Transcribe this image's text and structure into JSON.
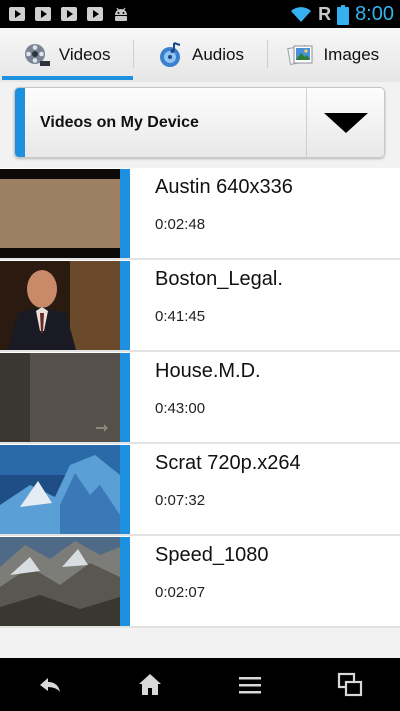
{
  "status_bar": {
    "notification_icons": [
      "youtube-icon",
      "youtube-icon",
      "youtube-icon",
      "youtube-icon",
      "android-icon"
    ],
    "roaming": "R",
    "time": "8:00",
    "time_color": "#36b1f0"
  },
  "tabs": [
    {
      "label": "Videos",
      "icon": "film-reel-icon",
      "active": true
    },
    {
      "label": "Audios",
      "icon": "music-icon",
      "active": false
    },
    {
      "label": "Images",
      "icon": "photos-icon",
      "active": false
    }
  ],
  "source_selector": {
    "label": "Videos on My Device"
  },
  "videos": [
    {
      "title": "Austin 640x336",
      "duration": "0:02:48"
    },
    {
      "title": "Boston_Legal.",
      "duration": "0:41:45"
    },
    {
      "title": "House.M.D.",
      "duration": "0:43:00"
    },
    {
      "title": "Scrat 720p.x264",
      "duration": "0:07:32"
    },
    {
      "title": "Speed_1080",
      "duration": "0:02:07"
    }
  ],
  "nav_bar": [
    "back-icon",
    "home-icon",
    "menu-icon",
    "recent-apps-icon"
  ],
  "accent_color": "#1e90e0"
}
